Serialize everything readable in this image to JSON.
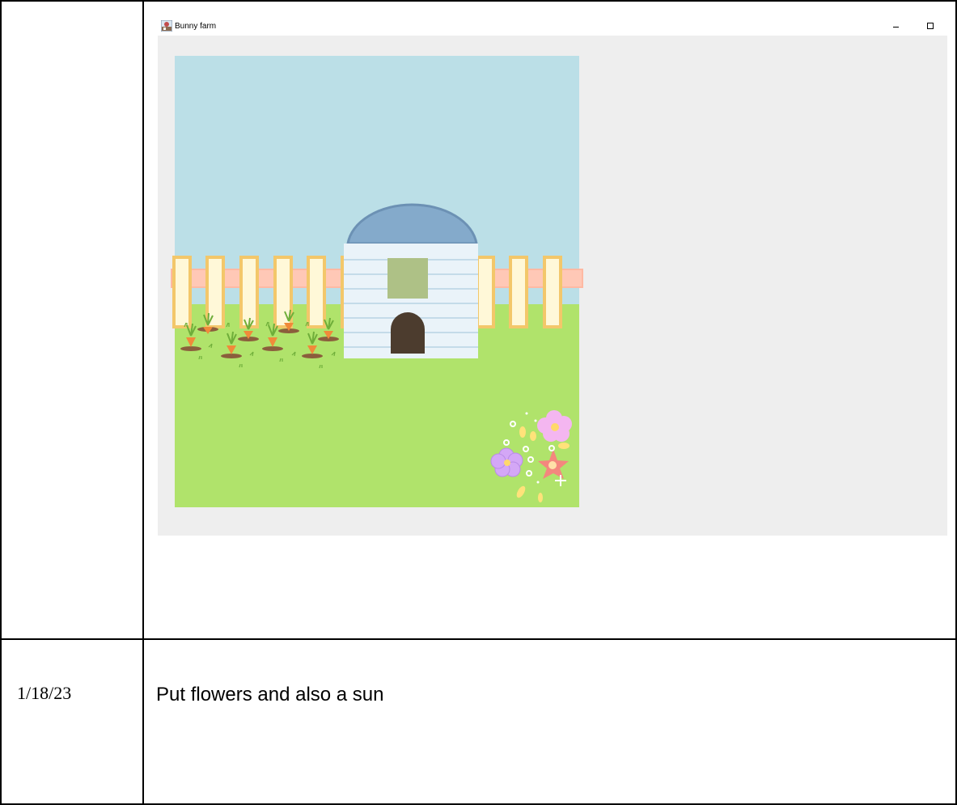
{
  "window": {
    "title": "Bunny farm",
    "minimize_glyph": "–",
    "maximize_glyph": "▢"
  },
  "log": {
    "date": "1/18/23",
    "note": "Put flowers and also a sun"
  },
  "scene": {
    "icons": [
      "app-icon",
      "fence",
      "hutch",
      "carrot-patch",
      "flower-cluster"
    ],
    "colors": {
      "sky": "#bbdfe7",
      "grass": "#b0e36b",
      "fence_post": "#fff8d8",
      "fence_border": "#f3c76a",
      "fence_rail": "#ffc8b6",
      "hutch_wall": "#eaf3f9",
      "hutch_stripe": "#c4dbe9",
      "hutch_roof": "#84aacb",
      "hutch_window": "#aec186",
      "hutch_door": "#4c3c2e",
      "soil": "#8b5e3c",
      "carrot": "#f08a3a",
      "leaf": "#6fae3a",
      "flower_pink": "#f4b6f0",
      "flower_purple": "#d4a7f6",
      "flower_red": "#f4877e",
      "flower_center": "#ffd86b"
    }
  }
}
